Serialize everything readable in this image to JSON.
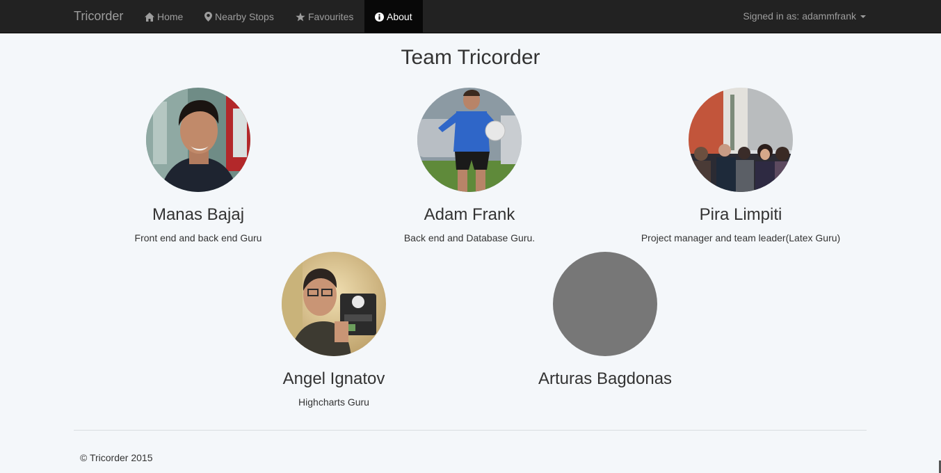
{
  "nav": {
    "brand": "Tricorder",
    "items": [
      {
        "label": "Home",
        "icon": "home-icon"
      },
      {
        "label": "Nearby Stops",
        "icon": "map-marker-icon"
      },
      {
        "label": "Favourites",
        "icon": "star-icon"
      },
      {
        "label": "About",
        "icon": "info-icon",
        "active": true
      }
    ],
    "user": "Signed in as: adammfrank"
  },
  "title": "Team Tricorder",
  "members": [
    {
      "name": "Manas Bajaj",
      "role": "Front end and back end Guru"
    },
    {
      "name": "Adam Frank",
      "role": "Back end and Database Guru."
    },
    {
      "name": "Pira Limpiti",
      "role": "Project manager and team leader(Latex Guru)"
    },
    {
      "name": "Angel Ignatov",
      "role": "Highcharts Guru"
    },
    {
      "name": "Arturas Bagdonas",
      "role": ""
    }
  ],
  "footer": "© Tricorder 2015",
  "colors": {
    "navbar": "#222222",
    "active_tab": "#080808",
    "page_bg": "#f4f7fa",
    "placeholder_avatar": "#777777"
  }
}
